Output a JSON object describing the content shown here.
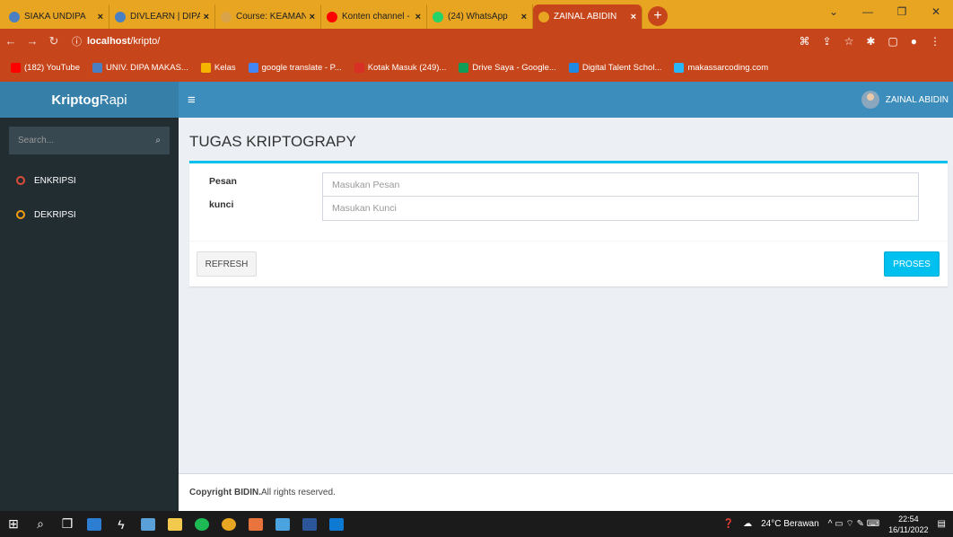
{
  "browser": {
    "tabs": [
      {
        "label": "SIAKA UNDIPA",
        "color": "#4a7fc1"
      },
      {
        "label": "DIVLEARN | DIPA V",
        "color": "#4a7fc1"
      },
      {
        "label": "Course: KEAMANA",
        "color": "#d9a34a"
      },
      {
        "label": "Konten channel - Y",
        "color": "#ff0000"
      },
      {
        "label": "(24) WhatsApp",
        "color": "#25d366"
      },
      {
        "label": "ZAINAL ABIDIN",
        "color": "#e8a521"
      }
    ],
    "new_tab": "+",
    "url_host": "localhost",
    "url_path": "/kripto/",
    "bookmarks": [
      {
        "label": "(182) YouTube",
        "color": "#ff0000"
      },
      {
        "label": "UNIV. DIPA MAKAS...",
        "color": "#4a7fc1"
      },
      {
        "label": "Kelas",
        "color": "#f4b400"
      },
      {
        "label": "google translate - P...",
        "color": "#4285f4"
      },
      {
        "label": "Kotak Masuk (249)...",
        "color": "#d93025"
      },
      {
        "label": "Drive Saya - Google...",
        "color": "#0f9d58"
      },
      {
        "label": "Digital Talent Schol...",
        "color": "#1e88e5"
      },
      {
        "label": "makassarcoding.com",
        "color": "#29b6f6"
      }
    ]
  },
  "app": {
    "logo_bold": "Kriptog",
    "logo_rest": "Rapi",
    "menu_icon": "≡",
    "user_name": "ZAINAL ABIDIN",
    "search_placeholder": "Search...",
    "sidebar": [
      {
        "label": "ENKRIPSI",
        "color": "#dd4b39"
      },
      {
        "label": "DEKRIPSI",
        "color": "#f39c12"
      }
    ],
    "page_title": "TUGAS KRIPTOGRAPY",
    "form": {
      "pesan_label": "Pesan",
      "pesan_placeholder": "Masukan Pesan",
      "kunci_label": "kunci",
      "kunci_placeholder": "Masukan Kunci",
      "refresh": "REFRESH",
      "proses": "PROSES"
    },
    "footer_bold": "Copyright BIDIN.",
    "footer_rest": " All rights reserved."
  },
  "taskbar": {
    "weather": "24°C Berawan",
    "time": "22:54",
    "date": "16/11/2022"
  }
}
